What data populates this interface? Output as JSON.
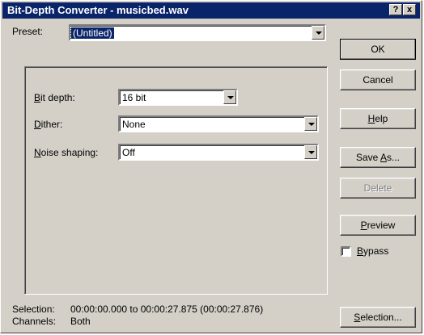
{
  "window": {
    "title": "Bit-Depth Converter - musicbed.wav",
    "help_glyph": "?",
    "close_glyph": "x"
  },
  "preset": {
    "label": "Preset:",
    "value": "(Untitled)"
  },
  "bit_depth": {
    "label_mnemonic": "B",
    "label_rest": "it depth:",
    "value": "16 bit"
  },
  "dither": {
    "label_mnemonic": "D",
    "label_rest": "ither:",
    "value": "None"
  },
  "noise_shaping": {
    "label_mnemonic": "N",
    "label_rest": "oise shaping:",
    "value": "Off"
  },
  "buttons": {
    "ok": "OK",
    "cancel": "Cancel",
    "help_mnemonic": "H",
    "help_rest": "elp",
    "save_as_pre": "Save ",
    "save_as_mnemonic": "A",
    "save_as_rest": "s...",
    "delete": "Delete",
    "preview_mnemonic": "P",
    "preview_rest": "review",
    "selection_mnemonic": "S",
    "selection_rest": "election..."
  },
  "bypass": {
    "label_mnemonic": "B",
    "label_rest": "ypass",
    "checked": false
  },
  "status": {
    "selection_label": "Selection:",
    "selection_value": "00:00:00.000 to 00:00:27.875 (00:00:27.876)",
    "channels_label": "Channels:",
    "channels_value": "Both"
  },
  "colors": {
    "titlebar": "#0a246a",
    "face": "#d4d0c8"
  }
}
